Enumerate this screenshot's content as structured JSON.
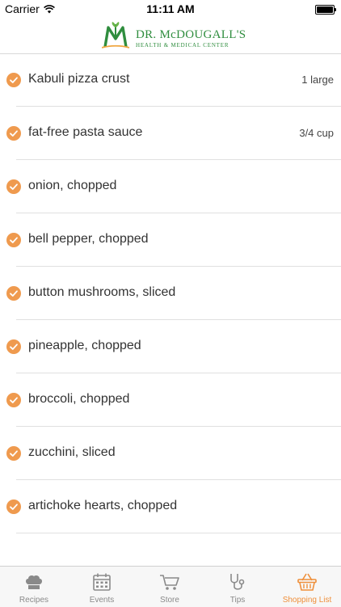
{
  "status_bar": {
    "carrier": "Carrier",
    "time": "11:11 AM"
  },
  "header": {
    "logo_title": "DR. McDOUGALL'S",
    "logo_subtitle": "HEALTH & MEDICAL CENTER",
    "brand_color": "#2f8d3e"
  },
  "accent_color": "#ef9a4e",
  "shopping_list": {
    "items": [
      {
        "name": "Kabuli pizza crust",
        "qty": "1 large",
        "checked": true
      },
      {
        "name": "fat-free pasta sauce",
        "qty": "3/4 cup",
        "checked": true
      },
      {
        "name": "onion, chopped",
        "qty": "",
        "checked": true
      },
      {
        "name": "bell pepper, chopped",
        "qty": "",
        "checked": true
      },
      {
        "name": "button mushrooms, sliced",
        "qty": "",
        "checked": true
      },
      {
        "name": "pineapple, chopped",
        "qty": "",
        "checked": true
      },
      {
        "name": "broccoli, chopped",
        "qty": "",
        "checked": true
      },
      {
        "name": "zucchini, sliced",
        "qty": "",
        "checked": true
      },
      {
        "name": "artichoke hearts, chopped",
        "qty": "",
        "checked": true
      }
    ]
  },
  "tabs": [
    {
      "label": "Recipes",
      "icon": "chef-hat-icon",
      "active": false
    },
    {
      "label": "Events",
      "icon": "calendar-icon",
      "active": false
    },
    {
      "label": "Store",
      "icon": "cart-icon",
      "active": false
    },
    {
      "label": "Tips",
      "icon": "stethoscope-icon",
      "active": false
    },
    {
      "label": "Shopping List",
      "icon": "basket-icon",
      "active": true
    }
  ]
}
